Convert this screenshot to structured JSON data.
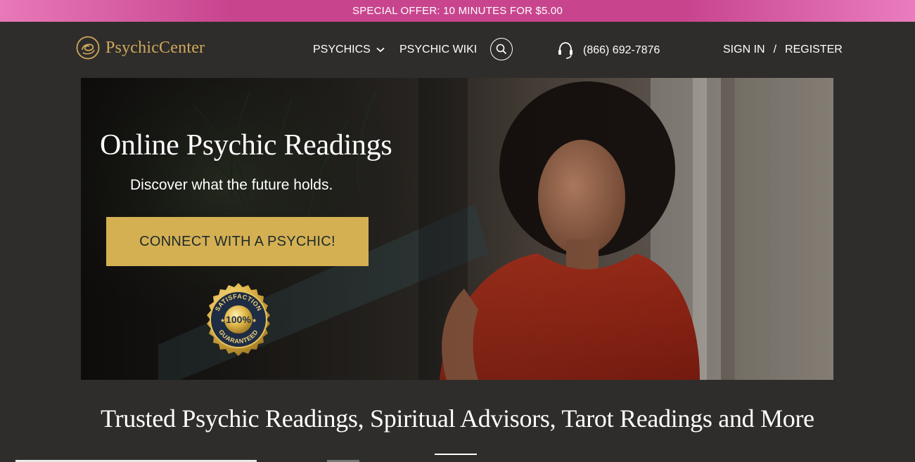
{
  "promo": {
    "text": "SPECIAL OFFER: 10 MINUTES FOR $5.00"
  },
  "header": {
    "logo_text": "PsychicCenter",
    "nav": {
      "psychics": "PSYCHICS",
      "wiki": "PSYCHIC WIKI"
    },
    "phone": "(866) 692-7876",
    "auth": {
      "sign_in": "SIGN IN",
      "separator": "/",
      "register": "REGISTER"
    }
  },
  "hero": {
    "title": "Online Psychic Readings",
    "subtitle": "Discover what the future holds.",
    "cta": "CONNECT WITH A PSYCHIC!",
    "badge": {
      "top": "SATISFACTION",
      "center": "100%",
      "bottom": "GUARANTEED"
    }
  },
  "section": {
    "heading": "Trusted Psychic Readings, Spiritual Advisors, Tarot Readings and More"
  },
  "colors": {
    "gold": "#cfa85c",
    "cta_gold": "#d4b053",
    "promo_pink": "#c8458e",
    "background": "#2f2d2b"
  }
}
